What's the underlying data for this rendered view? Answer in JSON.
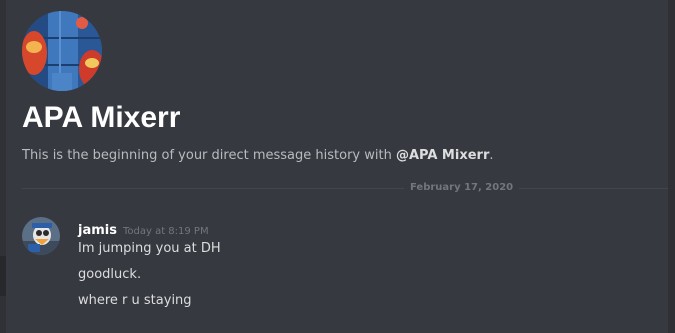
{
  "dm": {
    "name": "APA Mixerr",
    "intro_prefix": "This is the beginning of your direct message history with ",
    "intro_mention": "@APA Mixerr",
    "intro_suffix": "."
  },
  "divider": {
    "date": "February 17, 2020"
  },
  "messages": [
    {
      "author": "jamis",
      "timestamp": "Today at 8:19 PM",
      "lines": [
        "Im jumping you at DH",
        "goodluck.",
        "where r u staying"
      ]
    }
  ],
  "colors": {
    "background": "#36393f",
    "title": "#ffffff",
    "body_text": "#dcddde",
    "muted_text": "#72767d",
    "divider": "#42454a"
  },
  "icons": {
    "header_avatar": "profile-avatar-image",
    "message_avatar": "user-avatar-image"
  }
}
